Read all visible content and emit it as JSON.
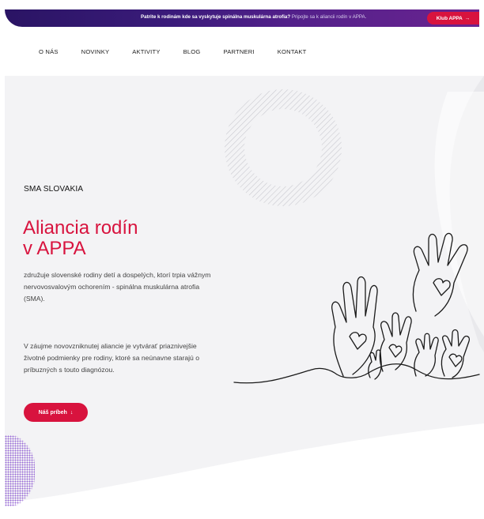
{
  "topbar": {
    "message_bold": "Patrite k rodinám kde sa vyskytuje spinálna muskulárna atrofia?",
    "message_rest": "Pripojte sa k aliancii rodín v APPA.",
    "club_button": "Klub APPA",
    "club_icon": "arrow-right-icon"
  },
  "nav": {
    "items": [
      "O NÁS",
      "NOVINKY",
      "AKTIVITY",
      "BLOG",
      "PARTNERI",
      "KONTAKT"
    ]
  },
  "hero": {
    "kicker": "SMA SLOVAKIA",
    "title_line1": "Aliancia rodín",
    "title_line2": "v APPA",
    "paragraph1": "združuje slovenské rodiny detí a dospelých, ktorí trpia vážnym nervovosvalovým ochorením - spinálna muskulárna atrofia (SMA).",
    "paragraph2": "V záujme novovzniknutej aliancie je vytvárať priaznivejšie životné podmienky pre rodiny, ktoré sa neúnavne starajú o príbuzných s touto diagnózou.",
    "story_button": "Náš príbeh",
    "story_icon": "arrow-down-icon",
    "illustration": "hands-with-hearts-line-art"
  },
  "colors": {
    "accent": "#d8133e",
    "banner_start": "#2a1464",
    "banner_end": "#6a2490",
    "hero_bg": "#f3f3f5",
    "dots": "#9a6cd6"
  }
}
